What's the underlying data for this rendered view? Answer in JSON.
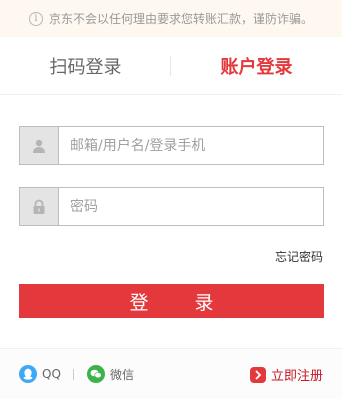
{
  "notice": {
    "icon": "info-icon",
    "text": "京东不会以任何理由要求您转账汇款，谨防诈骗。"
  },
  "tabs": [
    {
      "label": "扫码登录",
      "active": false
    },
    {
      "label": "账户登录",
      "active": true
    }
  ],
  "form": {
    "username": {
      "placeholder": "邮箱/用户名/登录手机",
      "value": "",
      "icon": "user-icon"
    },
    "password": {
      "placeholder": "密码",
      "value": "",
      "icon": "lock-icon"
    },
    "forgot_label": "忘记密码",
    "submit_label": "登 录"
  },
  "footer": {
    "qq_label": "QQ",
    "wechat_label": "微信",
    "register_label": "立即注册"
  },
  "colors": {
    "accent": "#e4393c",
    "notice_bg": "#fff8f0",
    "qq": "#3fa9f5",
    "wechat": "#3bb34a"
  }
}
